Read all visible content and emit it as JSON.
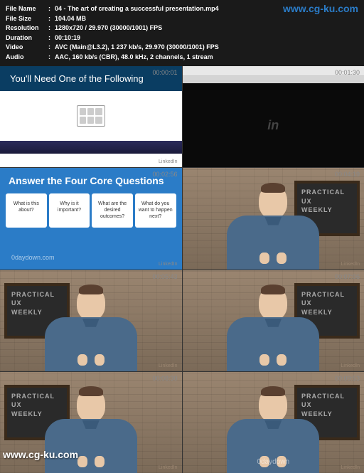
{
  "watermarks": {
    "top": "www.cg-ku.com",
    "bottom": "www.cg-ku.com"
  },
  "meta": {
    "file_name_label": "File Name",
    "file_name": "04 - The art of creating a successful presentation.mp4",
    "file_size_label": "File Size",
    "file_size": "104.04 MB",
    "resolution_label": "Resolution",
    "resolution": "1280x720 / 29.970 (30000/1001) FPS",
    "duration_label": "Duration",
    "duration": "00:10:19",
    "video_label": "Video",
    "video": "AVC (Main@L3.2), 1 237 kb/s, 29.970 (30000/1001) FPS",
    "audio_label": "Audio",
    "audio": "AAC, 160 kb/s (CBR), 48.0 kHz, 2 channels, 1 stream"
  },
  "brand": "LinkedIn",
  "slide1": {
    "title": "You'll Need One of the Following",
    "ts": "00:00:01"
  },
  "slide2": {
    "mark": "in",
    "ts": "00:01:30"
  },
  "slide3": {
    "title": "Answer the Four Core Questions",
    "cards": {
      "c1": "What is this about?",
      "c2": "Why is it important?",
      "c3": "What are the desired outcomes?",
      "c4": "What do you want to happen next?"
    },
    "wm": "0daydown.com",
    "ts": "00:02:56"
  },
  "presenter_board": {
    "line1": "PRACTICAL",
    "line2": "UX",
    "line3": "WEEKLY"
  },
  "timestamps": {
    "t4": "00:04:19",
    "t5": "00:05:43",
    "t6": "00:07:06",
    "t7": "00:08:30",
    "t8": "00:09:53"
  },
  "pres_wm": "0daydown"
}
